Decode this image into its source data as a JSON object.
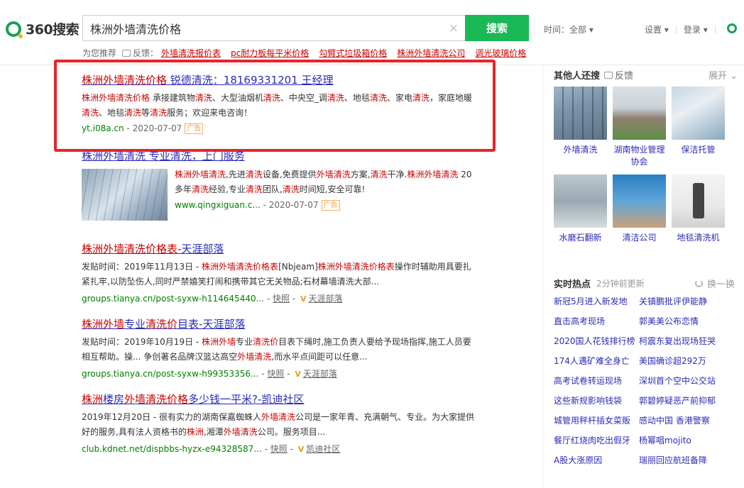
{
  "header": {
    "logo_text": "360搜索",
    "query": "株洲外墙清洗价格",
    "search_button": "搜索",
    "time_label": "时间：全部",
    "settings": "设置",
    "login": "登录"
  },
  "recommend": {
    "label": "为您推荐",
    "feedback": "反馈：",
    "items": [
      "外墙清洗报价表",
      "pc耐力板每平米价格",
      "勾臂式垃圾箱价格",
      "株洲外墙清洗公司",
      "调光玻璃价格"
    ]
  },
  "results": [
    {
      "title_hl": "株洲外墙清洗价格",
      "title_rest": " 锐德清洗：18169331201 王经理",
      "desc_html": "<span class='hl'>株洲外墙清洗价格</span> 承接建筑物<span class='hl'>清洗</span>、大型油烟机<span class='hl'>清洗</span>、中央空_调<span class='hl'>清洗</span>、地毯<span class='hl'>清洗</span>、家电<span class='hl'>清洗</span>，家庭地暖<span class='hl'>清洗</span>、地毯<span class='hl'>清洗</span>等<span class='hl'>清洗</span>服务；欢迎来电咨询！",
      "url": "yt.i08a.cn",
      "date": " - 2020-07-07",
      "ad": "广告"
    },
    {
      "title": "株洲外墙清洗 专业清洗，上门服务",
      "desc_html": "<span class='hl'>株洲外墙清洗</span>,先进<span class='hl'>清洗</span>设备,免费提供<span class='hl'>外墙清洗</span>方案,<span class='hl'>清洗</span>干净.<span class='hl'>株洲外墙清洗</span> 20多年<span class='hl'>清洗</span>经验,专业<span class='hl'>清洗</span>团队,<span class='hl'>清洗</span>时间短,安全可靠!",
      "url": "www.qingxiguan.c...",
      "date": " - 2020-07-07",
      "ad": "广告"
    },
    {
      "title_hl": "株洲外墙清洗价格表",
      "title_rest": "-天涯部落",
      "desc_html": "发贴时间：2019年11月13日 - <span class='hl'>株洲外墙清洗价格表</span>[Nbjeam]<span class='hl'>株洲外墙清洗价格表</span>操作时辅助用具要扎紧扎牢,以防坠伤人,同时严禁嬉笑打闹和携带其它无关物品;石材幕墙清洗大部...",
      "url": "groups.tianya.cn/post-syxw-h114645440...",
      "kz": "快照",
      "source": "天涯部落"
    },
    {
      "title_hl": "株洲外墙",
      "title_mid": "专业",
      "title_hl2": "清洗价",
      "title_rest": "目表-天涯部落",
      "desc_html": "发贴时间：2019年10月19日 - <span class='hl'>株洲外墙</span>专业<span class='hl'>清洗价</span>目表下绳时,施工负责人要给予现场指挥,施工人员要相互帮助。操... 争创著名品牌汉篮达高空<span class='hl'>外墙清洗</span>,而水平点间距可以任意...",
      "url": "groups.tianya.cn/post-syxw-h99353356...",
      "kz": "快照",
      "source": "天涯部落"
    },
    {
      "title_hl": "株洲",
      "title_mid": "楼房",
      "title_hl2": "外墙清洗价格",
      "title_rest": "多少钱一平米?-凯迪社区",
      "desc_html": "2019年12月20日 - 很有实力的湖南保嘉蜘蛛人<span class='hl'>外墙清洗</span>公司是一家年青、充满朝气、专业。为大家提供好的服务,具有法人资格书的<span class='hl'>株洲</span>,湘潭<span class='hl'>外墙清洗</span>公司。服务项目...",
      "url": "club.kdnet.net/dispbbs-hyzx-e94328587...",
      "kz": "快照",
      "source": "凯迪社区"
    }
  ],
  "sidebar": {
    "others_title": "其他人还搜",
    "feedback": "反馈",
    "expand": "展开",
    "pictures": [
      "外墙清洗",
      "湖南物业管理协会",
      "保洁托管",
      "水磨石翻新",
      "清洁公司",
      "地毯清洗机"
    ],
    "hot_title": "实时热点",
    "hot_updated": "2分钟前更新",
    "hot_change": "换一换",
    "hot_items": [
      "新冠5月进入新发地",
      "关镇鹏批评伊能静",
      "直击高考现场",
      "郭美美公布恋情",
      "2020国人花钱排行榜",
      "柯震东复出现场狂哭",
      "174人遇矿难全身亡",
      "美国确诊超292万",
      "高考试卷转运现场",
      "深圳首个空中公交站",
      "这些新规影响钱袋",
      "郭碧婷疑恶产前抑郁",
      "城管用秤杆插女菜贩",
      "感动中国 香港警察",
      "餐厅红烧肉吃出假牙",
      "杨幂唱mojito",
      "A股大涨原因",
      "瑞丽回应航班备降"
    ]
  },
  "colors": {
    "accent": "#19b955",
    "link": "#2b2bbb",
    "highlight": "#cc0000",
    "annotation_box": "#e8242a"
  }
}
